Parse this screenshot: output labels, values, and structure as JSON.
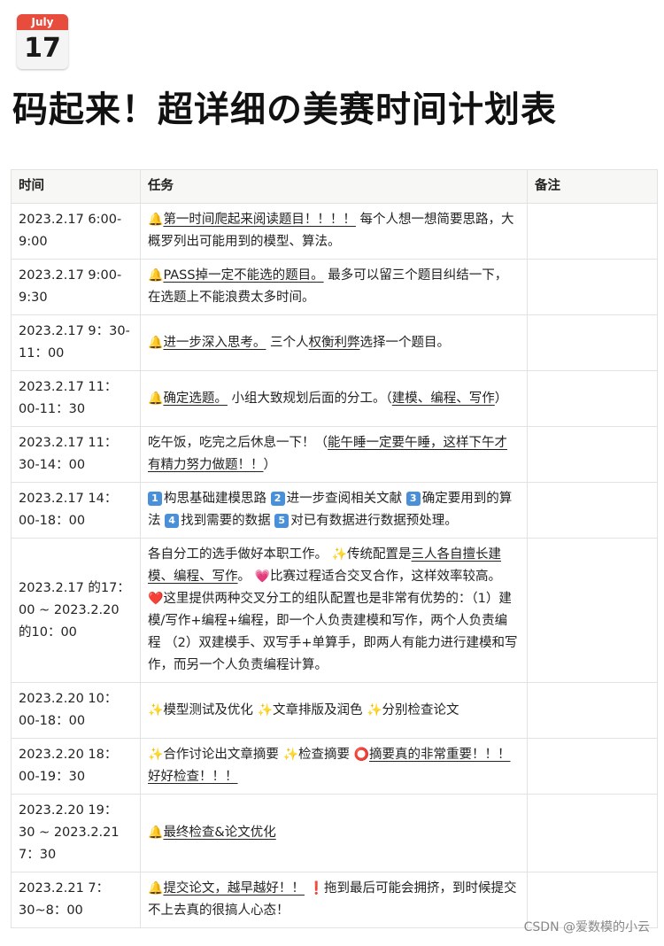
{
  "header": {
    "calendar_month": "July",
    "calendar_day": "17",
    "title": "码起来！超详细の美赛时间计划表"
  },
  "table": {
    "headers": [
      "时间",
      "任务",
      "备注"
    ],
    "rows": [
      {
        "time": "2023.2.17 6:00-9:00",
        "task": [
          {
            "t": "🔔",
            "c": "em"
          },
          {
            "t": "第一时间爬起来阅读题目！！！！",
            "c": "u"
          },
          {
            "t": " 每个人想一想简要思路，大概罗列出可能用到的模型、算法。"
          }
        ],
        "note": ""
      },
      {
        "time": "2023.2.17 9:00-9:30",
        "task": [
          {
            "t": "🔔",
            "c": "em"
          },
          {
            "t": "PASS掉一定不能选的题目。",
            "c": "u"
          },
          {
            "t": " 最多可以留三个题目纠结一下，在选题上不能浪费太多时间。"
          }
        ],
        "note": ""
      },
      {
        "time": "2023.2.17 9：30-11：00",
        "task": [
          {
            "t": "🔔",
            "c": "em"
          },
          {
            "t": "进一步深入思考。",
            "c": "u"
          },
          {
            "t": " 三个人"
          },
          {
            "t": "权衡利弊",
            "c": "u"
          },
          {
            "t": "选择一个题目。"
          }
        ],
        "note": ""
      },
      {
        "time": "2023.2.17 11：00-11：30",
        "task": [
          {
            "t": "🔔",
            "c": "em"
          },
          {
            "t": "确定选题。",
            "c": "u"
          },
          {
            "t": " 小组大致规划后面的分工。（"
          },
          {
            "t": "建模、编程、写作",
            "c": "u"
          },
          {
            "t": "）"
          }
        ],
        "note": ""
      },
      {
        "time": "2023.2.17 11：30-14：00",
        "task": [
          {
            "t": "吃午饭，吃完之后休息一下！（"
          },
          {
            "t": "能午睡一定要午睡，这样下午才有精力努力做题！！",
            "c": "u"
          },
          {
            "t": "）"
          }
        ],
        "note": ""
      },
      {
        "time": "2023.2.17 14：00-18：00",
        "task": [
          {
            "t": "1",
            "c": "badge"
          },
          {
            "t": "构思基础建模思路 "
          },
          {
            "t": "2",
            "c": "badge"
          },
          {
            "t": "进一步查阅相关文献 "
          },
          {
            "t": "3",
            "c": "badge"
          },
          {
            "t": "确定要用到的算法 "
          },
          {
            "t": "4",
            "c": "badge"
          },
          {
            "t": "找到需要的数据 "
          },
          {
            "t": "5",
            "c": "badge"
          },
          {
            "t": "对已有数据进行数据预处理。"
          }
        ],
        "note": ""
      },
      {
        "time": "2023.2.17 的17：00 ~ 2023.2.20 的10：00",
        "task": [
          {
            "t": "各自分工的选手做好本职工作。 "
          },
          {
            "t": "✨",
            "c": "em"
          },
          {
            "t": "传统配置是"
          },
          {
            "t": "三人各自擅长建模、编程、写作",
            "c": "u"
          },
          {
            "t": "。 "
          },
          {
            "t": "💗",
            "c": "em"
          },
          {
            "t": "比赛过程适合交叉合作，这样效率较高。 "
          },
          {
            "t": "❤️",
            "c": "em"
          },
          {
            "t": "这里提供两种交叉分工的组队配置也是非常有优势的：（1）建模/写作+编程+编程，即一个人负责建模和写作，两个人负责编程 （2）双建模手、双写手+单算手，即两人有能力进行建模和写作，而另一个人负责编程计算。"
          }
        ],
        "note": ""
      },
      {
        "time": "2023.2.20 10：00-18：00",
        "task": [
          {
            "t": "✨",
            "c": "em"
          },
          {
            "t": "模型测试及优化 "
          },
          {
            "t": "✨",
            "c": "em"
          },
          {
            "t": "文章排版及润色 "
          },
          {
            "t": "✨",
            "c": "em"
          },
          {
            "t": "分别检查论文"
          }
        ],
        "note": ""
      },
      {
        "time": "2023.2.20 18：00-19：30",
        "task": [
          {
            "t": "✨",
            "c": "em"
          },
          {
            "t": "合作讨论出文章摘要 "
          },
          {
            "t": "✨",
            "c": "em"
          },
          {
            "t": "检查摘要 "
          },
          {
            "t": "⭕",
            "c": "em"
          },
          {
            "t": "摘要真的非常重要！！！好好检查！！！",
            "c": "u"
          }
        ],
        "note": ""
      },
      {
        "time": "2023.2.20 19：30 ~ 2023.2.21 7：30",
        "task": [
          {
            "t": "🔔",
            "c": "em"
          },
          {
            "t": "最终检查&论文优化",
            "c": "u"
          }
        ],
        "note": ""
      },
      {
        "time": "2023.2.21 7：30~8：00",
        "task": [
          {
            "t": "🔔",
            "c": "em"
          },
          {
            "t": "提交论文，越早越好！！",
            "c": "u"
          },
          {
            "t": " "
          },
          {
            "t": "❗",
            "c": "em"
          },
          {
            "t": "拖到最后可能会拥挤，到时候提交不上去真的很搞人心态！"
          }
        ],
        "note": ""
      }
    ]
  },
  "watermark": "CSDN @爱数模的小云"
}
